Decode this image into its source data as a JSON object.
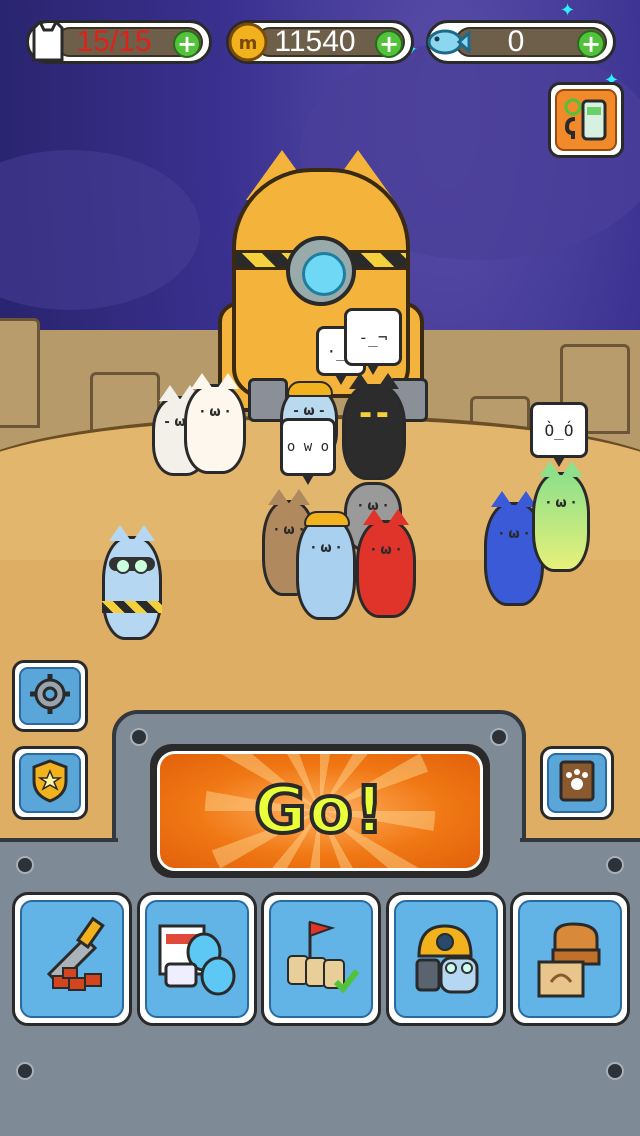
{
  "hud": {
    "stamina": {
      "value": "15/15",
      "color": "#e0201a",
      "icon": "cat-head-icon"
    },
    "coins": {
      "value": "11540",
      "icon": "coin-icon"
    },
    "fish": {
      "value": "0",
      "icon": "fish-icon"
    }
  },
  "speech_bubbles": {
    "left": "·_·",
    "top": "-_¬",
    "middle": "o w o",
    "right": "Ò_Ó"
  },
  "main_button": {
    "label": "Go!"
  },
  "side_buttons": {
    "settings": {
      "icon": "gear-icon"
    },
    "badge": {
      "icon": "star-badge-icon"
    },
    "walkie": {
      "icon": "walkie-talkie-help-icon"
    },
    "catbook": {
      "icon": "paw-book-icon"
    }
  },
  "toolbar": [
    {
      "name": "drill-upgrade",
      "icon": "drill-ore-icon"
    },
    {
      "name": "equipment-shop",
      "icon": "catalog-capsule-icon"
    },
    {
      "name": "team-select",
      "icon": "flag-team-check-icon"
    },
    {
      "name": "cat-gacha",
      "icon": "helmet-cat-icon"
    },
    {
      "name": "storage",
      "icon": "chest-crate-icon"
    }
  ],
  "colors": {
    "go": "#f07814",
    "go_text": "#e8ff3a",
    "plus": "#52c23a",
    "button_blue": "#5ba6d9",
    "panel": "#7e8a96"
  }
}
